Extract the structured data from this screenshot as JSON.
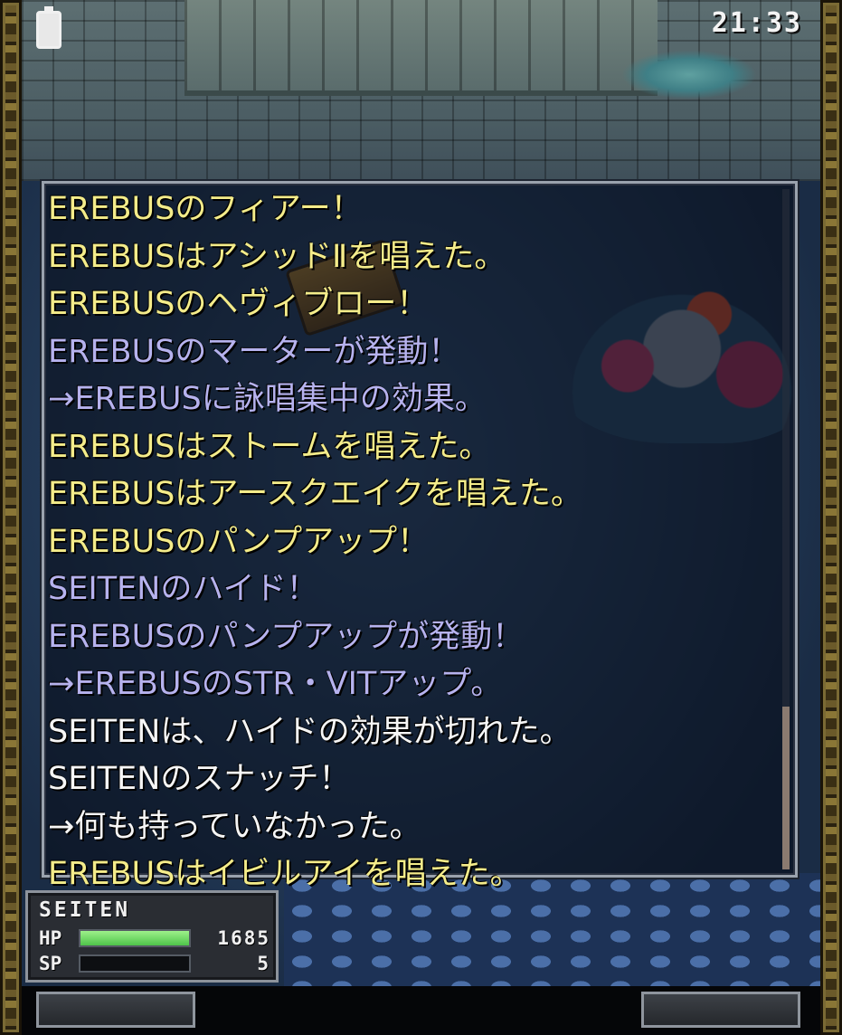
{
  "status_bar": {
    "time": "21:33",
    "battery_icon": "battery-icon"
  },
  "battle_log": {
    "lines": [
      {
        "text": "EREBUSのフィアー！",
        "color": "yellow"
      },
      {
        "text": "EREBUSはアシッドⅡを唱えた。",
        "color": "yellow"
      },
      {
        "text": "EREBUSのヘヴィブロー！",
        "color": "yellow"
      },
      {
        "text": "EREBUSのマーターが発動！",
        "color": "lavender"
      },
      {
        "text": "→EREBUSに詠唱集中の効果。",
        "color": "lavender"
      },
      {
        "text": "EREBUSはストームを唱えた。",
        "color": "yellow"
      },
      {
        "text": "EREBUSはアースクエイクを唱えた。",
        "color": "yellow"
      },
      {
        "text": "EREBUSのパンプアップ！",
        "color": "yellow"
      },
      {
        "text": "SEITENのハイド！",
        "color": "lavender"
      },
      {
        "text": "EREBUSのパンプアップが発動！",
        "color": "lavender"
      },
      {
        "text": "→EREBUSのSTR・VITアップ。",
        "color": "lavender"
      },
      {
        "text": "SEITENは、ハイドの効果が切れた。",
        "color": "white"
      },
      {
        "text": "SEITENのスナッチ！",
        "color": "white"
      },
      {
        "text": "→何も持っていなかった。",
        "color": "white"
      },
      {
        "text": "EREBUSはイビルアイを唱えた。",
        "color": "yellow"
      }
    ],
    "colors": {
      "yellow": "#f4ec8a",
      "lavender": "#b6b2ee",
      "white": "#f6f6f6"
    }
  },
  "player_status": {
    "name": "SEITEN",
    "hp_label": "HP",
    "hp_value": "1685",
    "hp_fill": 1.0,
    "sp_label": "SP",
    "sp_value": "5",
    "sp_fill": 0.0,
    "hp_color": "#4fc44a"
  },
  "softkeys": {
    "left": "",
    "right": ""
  }
}
